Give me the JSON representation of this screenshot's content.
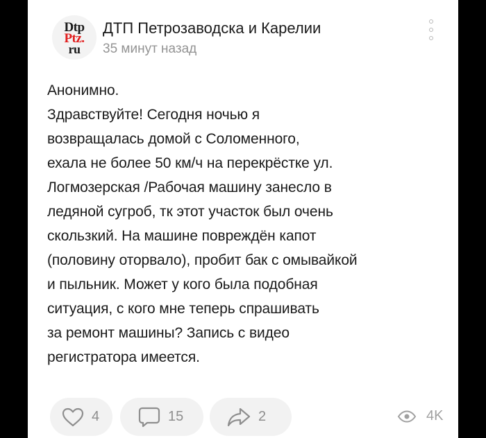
{
  "post": {
    "author": "ДТП Петрозаводска и Карелии",
    "time": "35 минут назад",
    "avatar_logo": [
      "Dtp",
      "Ptz.",
      "ru"
    ],
    "text_lines": [
      "Анонимно.",
      "Здравствуйте! Сегодня ночью я",
      "возвращалась домой с Соломенного,",
      "ехала не более 50 км/ч на перекрёстке ул.",
      "Логмозерская /Рабочая машину занесло в",
      "ледяной сугроб, тк этот участок был очень",
      "скользкий. На машине повреждён капот",
      "(половину оторвало), пробит бак с омывайкой",
      "и пыльник. Может у кого была подобная",
      "ситуация, с кого мне теперь спрашивать",
      "за  ремонт машины? Запись с видео",
      "регистратора имеется."
    ]
  },
  "actions": {
    "likes": "4",
    "comments": "15",
    "shares": "2",
    "views": "4K"
  },
  "icons": {
    "like": "heart-icon",
    "comment": "comment-icon",
    "share": "share-icon",
    "views": "eye-icon",
    "menu": "more-vertical-icon"
  },
  "colors": {
    "text": "#1a1a1a",
    "muted": "#939393",
    "pill_bg": "#f2f2f2",
    "logo_red": "#e11d1d"
  }
}
